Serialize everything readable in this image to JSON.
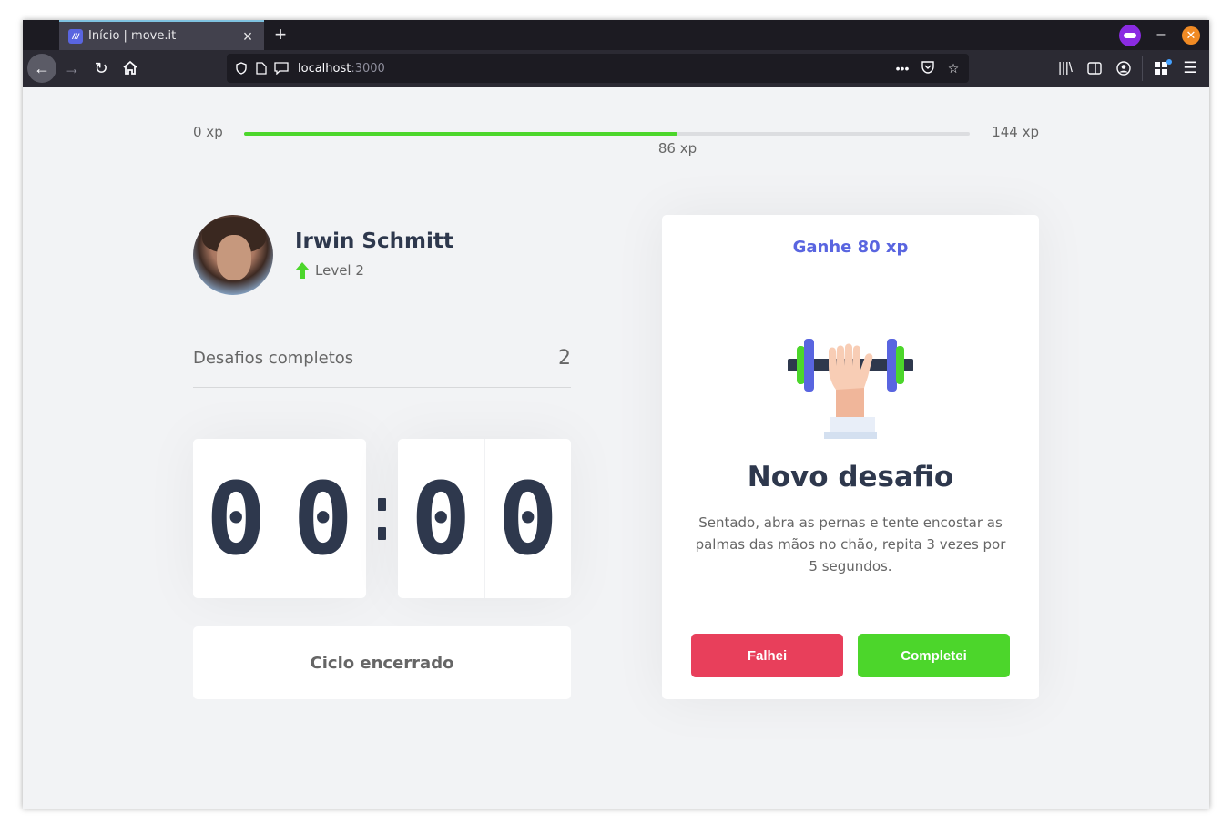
{
  "browser": {
    "tab_title": "Início | move.it",
    "tab_favicon": "///",
    "url_host": "localhost",
    "url_port": ":3000"
  },
  "experience": {
    "min_label": "0 xp",
    "max_label": "144 xp",
    "current_label": "86 xp",
    "current": 86,
    "max": 144
  },
  "profile": {
    "name": "Irwin Schmitt",
    "level_label": "Level 2"
  },
  "completed_challenges": {
    "label": "Desafios completos",
    "count": "2"
  },
  "countdown": {
    "minute_left": "0",
    "minute_right": "0",
    "second_left": "0",
    "second_right": "0"
  },
  "cycle_button": {
    "label": "Ciclo encerrado"
  },
  "challenge": {
    "header": "Ganhe 80 xp",
    "title": "Novo desafio",
    "description": "Sentado, abra as pernas e tente encostar as palmas das mãos no chão, repita 3 vezes por 5 segundos.",
    "failed_label": "Falhei",
    "completed_label": "Completei",
    "icon": "dumbbell-hand-icon"
  },
  "colors": {
    "accent_blue": "#5965e0",
    "green": "#4cd62b",
    "red": "#e83f5b",
    "title": "#2e384d",
    "text": "#666666"
  }
}
